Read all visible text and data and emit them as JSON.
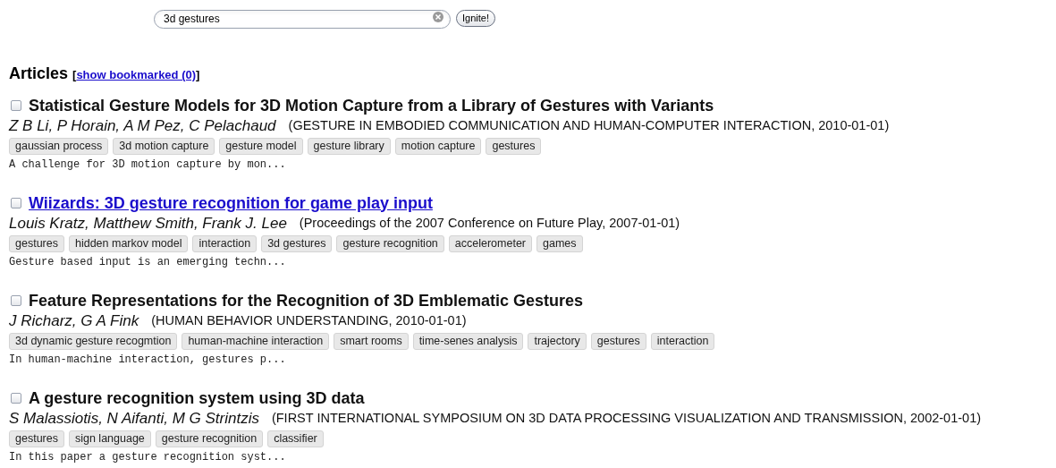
{
  "search": {
    "value": "3d gestures",
    "button": "Ignite!"
  },
  "heading": {
    "title": "Articles",
    "open": "[",
    "link": "show bookmarked (0)",
    "close": "]"
  },
  "articles": [
    {
      "checked": false,
      "highlighted": false,
      "title": "Statistical Gesture Models for 3D Motion Capture from a Library of Gestures with Variants",
      "authors": "Z B Li, P Horain, A M Pez, C Pelachaud",
      "source": "(GESTURE IN EMBODIED COMMUNICATION AND HUMAN-COMPUTER INTERACTION, 2010-01-01)",
      "tags": [
        "gaussian process",
        "3d motion capture",
        "gesture model",
        "gesture library",
        "motion capture",
        "gestures"
      ],
      "snippet": "A challenge for 3D motion capture by mon..."
    },
    {
      "checked": false,
      "highlighted": true,
      "title": "Wiizards: 3D gesture recognition for game play input",
      "authors": "Louis Kratz, Matthew Smith, Frank J. Lee",
      "source": "(Proceedings of the 2007 Conference on Future Play, 2007-01-01)",
      "tags": [
        "gestures",
        "hidden markov model",
        "interaction",
        "3d gestures",
        "gesture recognition",
        "accelerometer",
        "games"
      ],
      "snippet": "Gesture based input is an emerging techn..."
    },
    {
      "checked": false,
      "highlighted": false,
      "title": "Feature Representations for the Recognition of 3D Emblematic Gestures",
      "authors": "J Richarz, G A Fink",
      "source": "(HUMAN BEHAVIOR UNDERSTANDING, 2010-01-01)",
      "tags": [
        "3d dynamic gesture recogmtion",
        "human-machine interaction",
        "smart rooms",
        "time-senes analysis",
        "trajectory",
        "gestures",
        "interaction"
      ],
      "snippet": "In human-machine interaction, gestures p..."
    },
    {
      "checked": false,
      "highlighted": false,
      "title": "A gesture recognition system using 3D data",
      "authors": "S Malassiotis, N Aifanti, M G Strintzis",
      "source": "(FIRST INTERNATIONAL SYMPOSIUM ON 3D DATA PROCESSING VISUALIZATION AND TRANSMISSION, 2002-01-01)",
      "tags": [
        "gestures",
        "sign language",
        "gesture recognition",
        "classifier"
      ],
      "snippet": "In this paper a gesture recognition syst..."
    }
  ]
}
